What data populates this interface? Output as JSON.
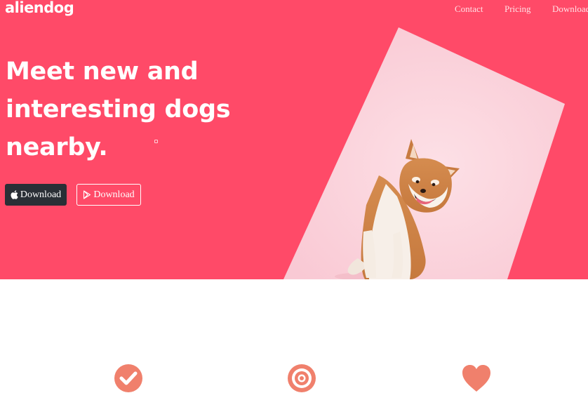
{
  "brand": {
    "name": "aliendog"
  },
  "nav": {
    "items": [
      {
        "label": "Contact"
      },
      {
        "label": "Pricing"
      },
      {
        "label": "Download"
      }
    ]
  },
  "hero": {
    "headline_lines": [
      "Meet new and",
      "interesting dogs",
      "nearby."
    ],
    "buttons": [
      {
        "label": "Download",
        "icon": "apple-icon"
      },
      {
        "label": "Download",
        "icon": "play-store-icon"
      }
    ]
  },
  "features": {
    "icons": [
      "check-circle-icon",
      "target-icon",
      "heart-icon"
    ]
  },
  "colors": {
    "hero_background": "#ff4a68",
    "photo_background": "#fbd3dc",
    "apple_button": "#2a2f36",
    "feature_icon": "#f0806c"
  }
}
